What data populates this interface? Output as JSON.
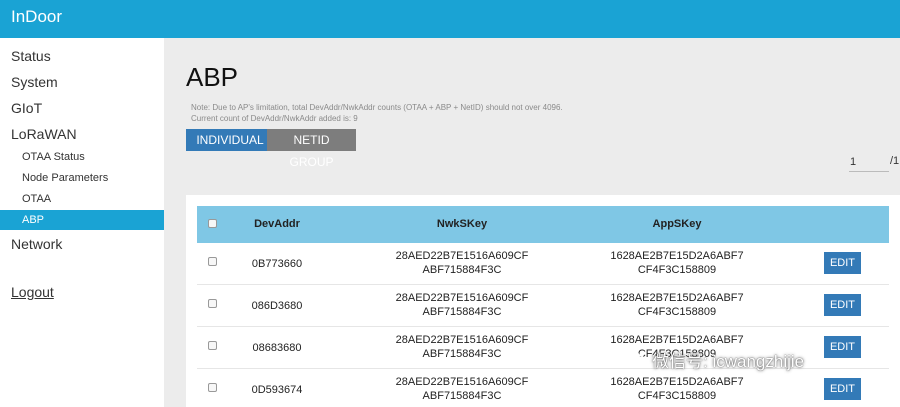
{
  "app": {
    "brand": "InDoor"
  },
  "sidebar": {
    "items": [
      {
        "label": "Status"
      },
      {
        "label": "System"
      },
      {
        "label": "GIoT"
      },
      {
        "label": "LoRaWAN"
      },
      {
        "label": "OTAA Status"
      },
      {
        "label": "Node Parameters"
      },
      {
        "label": "OTAA"
      },
      {
        "label": "ABP"
      },
      {
        "label": "Network"
      },
      {
        "label": "Logout"
      }
    ],
    "active": "ABP"
  },
  "main": {
    "title": "ABP",
    "note_line1": "Note: Due to AP's limitation, total DevAddr/NwkAddr counts (OTAA + ABP + NetID) should not over 4096.",
    "note_line2": "Current count of DevAddr/NwkAddr added is: 9",
    "buttons": {
      "individual": "INDIVIDUAL",
      "netid_group": "NETID GROUP"
    },
    "pager": {
      "current": "1",
      "total": "/1"
    }
  },
  "table": {
    "headers": {
      "devaddr": "DevAddr",
      "nwkskey": "NwkSKey",
      "appskey": "AppSKey"
    },
    "edit_label": "EDIT",
    "rows": [
      {
        "devaddr": "0B773660",
        "nwk1": "28AED22B7E1516A609CF",
        "nwk2": "ABF715884F3C",
        "app1": "1628AE2B7E15D2A6ABF7",
        "app2": "CF4F3C158809"
      },
      {
        "devaddr": "086D3680",
        "nwk1": "28AED22B7E1516A609CF",
        "nwk2": "ABF715884F3C",
        "app1": "1628AE2B7E15D2A6ABF7",
        "app2": "CF4F3C158809"
      },
      {
        "devaddr": "08683680",
        "nwk1": "28AED22B7E1516A609CF",
        "nwk2": "ABF715884F3C",
        "app1": "1628AE2B7E15D2A6ABF7",
        "app2": "CF4F3C158809"
      },
      {
        "devaddr": "0D593674",
        "nwk1": "28AED22B7E1516A609CF",
        "nwk2": "ABF715884F3C",
        "app1": "1628AE2B7E15D2A6ABF7",
        "app2": "CF4F3C158809"
      }
    ]
  },
  "watermark": {
    "text": "微信号: icwangzhijie",
    "icon": "wechat-icon"
  },
  "colors": {
    "accent": "#1aa3d4",
    "header_row": "#7fc7e5",
    "button_primary": "#337ab7",
    "button_secondary": "#7d7d7d"
  }
}
